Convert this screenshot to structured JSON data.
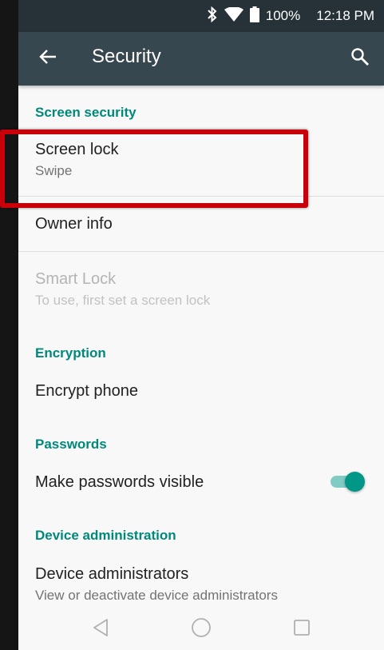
{
  "status_bar": {
    "battery": "100%",
    "time": "12:18 PM",
    "icons": [
      "bluetooth-icon",
      "wifi-icon",
      "battery-icon"
    ]
  },
  "app_bar": {
    "title": "Security",
    "back_icon": "arrow-back-icon",
    "search_icon": "search-icon",
    "background": "#37474f"
  },
  "sections": {
    "screen_security": "Screen security",
    "encryption": "Encryption",
    "passwords": "Passwords",
    "device_administration": "Device administration"
  },
  "items": {
    "screen_lock": {
      "title": "Screen lock",
      "summary": "Swipe"
    },
    "owner_info": {
      "title": "Owner info"
    },
    "smart_lock": {
      "title": "Smart Lock",
      "summary": "To use, first set a screen lock",
      "enabled": false
    },
    "encrypt_phone": {
      "title": "Encrypt phone"
    },
    "make_passwords_visible": {
      "title": "Make passwords visible",
      "toggle_on": true
    },
    "device_administrators": {
      "title": "Device administrators",
      "summary": "View or deactivate device administrators"
    }
  },
  "colors": {
    "accent": "#00897b",
    "highlight_box": "#c8000a",
    "toggle_on": "#009688"
  },
  "navigation_bar": [
    "back-icon",
    "home-icon",
    "recents-icon"
  ]
}
